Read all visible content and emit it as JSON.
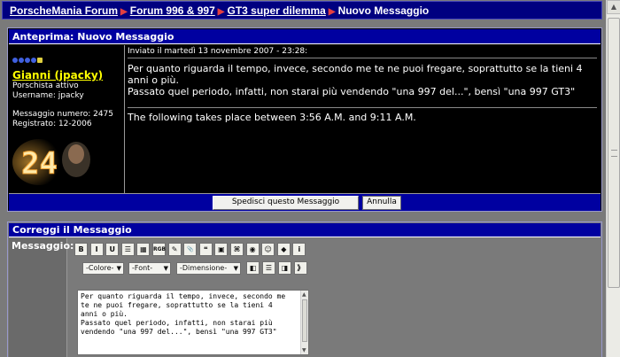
{
  "breadcrumb": {
    "items": [
      "PorscheMania Forum",
      "Forum 996 & 997",
      "GT3 super dilemma"
    ],
    "current": "Nuovo Messaggio"
  },
  "preview": {
    "header": "Anteprima: Nuovo Messaggio",
    "user": {
      "name": "Gianni (jpacky)",
      "rank": "Porschista attivo",
      "username": "Username: jpacky",
      "message_count": "Messaggio numero: 2475",
      "registered": "Registrato: 12-2006",
      "avatar_text": "24"
    },
    "post_meta": "Inviato il martedì 13 novembre 2007 - 23:28:",
    "body_line1": "Per quanto riguarda il tempo, invece, secondo me te ne puoi fregare, soprattutto se la tieni 4 anni o più.",
    "body_line2": "Passato quel periodo, infatti, non starai più vendendo \"una 997 del...\", bensì \"una 997 GT3\"",
    "signature": "The following takes place between 3:56 A.M. and 9:11 A.M.",
    "send_button": "Spedisci questo Messaggio",
    "cancel_button": "Annulla"
  },
  "edit": {
    "header": "Correggi il Messaggio",
    "label": "Messaggio:",
    "toolbar1": [
      {
        "name": "bold-button",
        "glyph": "B"
      },
      {
        "name": "italic-button",
        "glyph": "I"
      },
      {
        "name": "underline-button",
        "glyph": "U"
      },
      {
        "name": "list-button",
        "glyph": "☰"
      },
      {
        "name": "table-button",
        "glyph": "▦"
      },
      {
        "name": "color-button",
        "glyph": "RGB"
      },
      {
        "name": "edit-button",
        "glyph": "✎"
      },
      {
        "name": "attach-button",
        "glyph": "📎"
      },
      {
        "name": "quote-button",
        "glyph": "❝"
      },
      {
        "name": "image-button",
        "glyph": "▣"
      },
      {
        "name": "link-button",
        "glyph": "⌘"
      },
      {
        "name": "globe-button",
        "glyph": "◉"
      },
      {
        "name": "smiley-button",
        "glyph": "☺"
      },
      {
        "name": "book-button",
        "glyph": "◆"
      },
      {
        "name": "info-button",
        "glyph": "i"
      }
    ],
    "select_color": "-Colore-",
    "select_font": "-Font-",
    "select_size": "-Dimensione-",
    "toolbar2": [
      {
        "name": "align-left-button",
        "glyph": "◧"
      },
      {
        "name": "align-center-button",
        "glyph": "☰"
      },
      {
        "name": "align-right-button",
        "glyph": "◨"
      },
      {
        "name": "close-tags-button",
        "glyph": "》"
      }
    ],
    "textarea": "Per quanto riguarda il tempo, invece, secondo me\nte ne puoi fregare, soprattutto se la tieni 4\nanni o più.\nPassato quel periodo, infatti, non starai più\nvendendo \"una 997 del...\", bensì \"una 997 GT3\""
  },
  "colors": {
    "nav_bg": "#000080",
    "header_bg": "#0000a0",
    "username": "#ffff00",
    "separator": "#e34040"
  }
}
